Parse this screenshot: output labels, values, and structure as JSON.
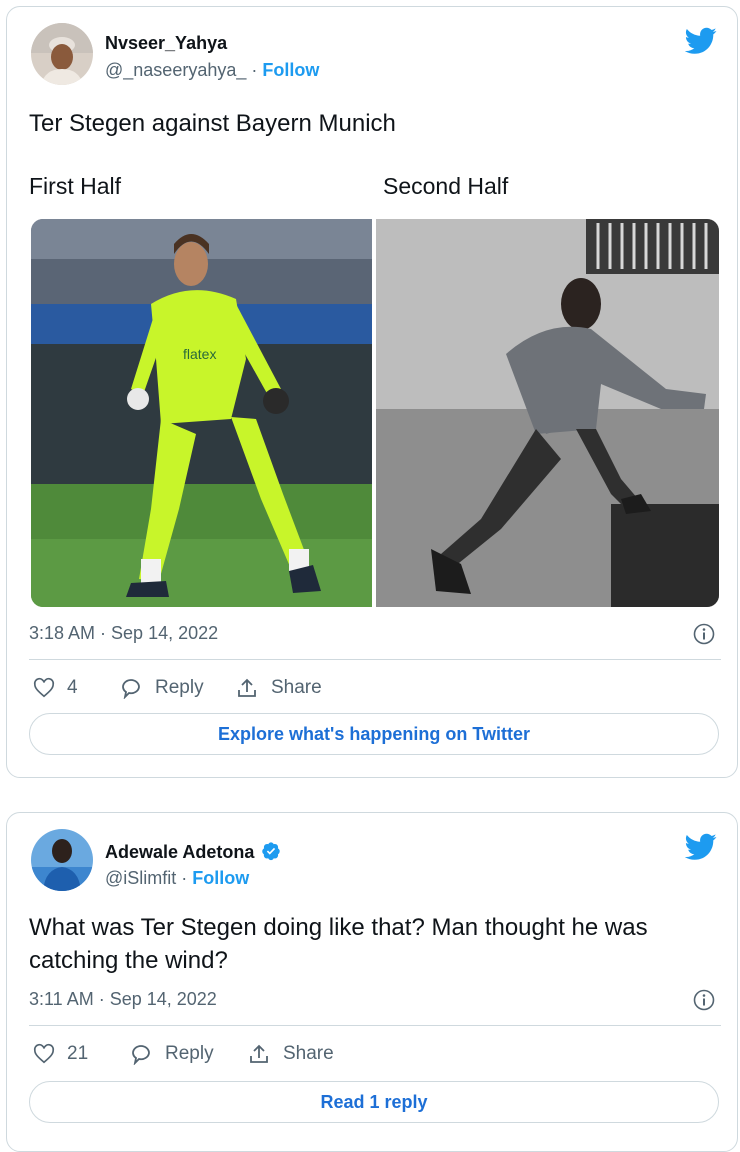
{
  "tweets": [
    {
      "name": "Nvseer_Yahya",
      "handle": "@_naseeryahya_",
      "separator": " · ",
      "follow_label": "Follow",
      "text": "Ter Stegen against Bayern Munich",
      "captions": [
        "First Half",
        "Second Half"
      ],
      "timestamp": "3:18 AM · Sep 14, 2022",
      "like_count": "4",
      "reply_label": "Reply",
      "share_label": "Share",
      "cta_label": "Explore what's happening on Twitter"
    },
    {
      "name": "Adewale Adetona",
      "verified": true,
      "handle": "@iSlimfit",
      "separator": " · ",
      "follow_label": "Follow",
      "text_line1": "What was Ter Stegen doing like that? Man thought he was",
      "text_line2": "catching the wind?",
      "timestamp": "3:11 AM · Sep 14, 2022",
      "like_count": "21",
      "reply_label": "Reply",
      "share_label": "Share",
      "cta_label": "Read 1 reply"
    }
  ],
  "colors": {
    "twitter_blue": "#1d9bf0",
    "link_blue": "#1d6fd6",
    "secondary_text": "#536471",
    "border": "#cfd9de",
    "goalkeeper_kit": "#c8f52a"
  }
}
